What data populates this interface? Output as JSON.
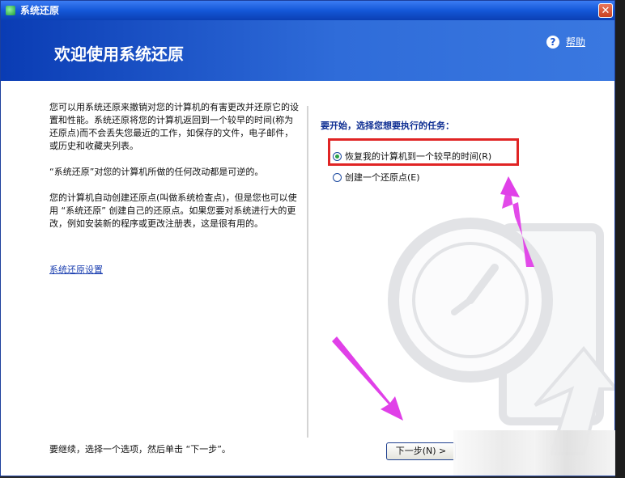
{
  "window": {
    "title": "系统还原",
    "close_glyph": "✕"
  },
  "header": {
    "heading": "欢迎使用系统还原",
    "help_label": "帮助",
    "help_glyph": "?"
  },
  "left": {
    "paragraphs": [
      "您可以用系统还原来撤销对您的计算机的有害更改并还原它的设置和性能。系统还原将您的计算机返回到一个较早的时间(称为还原点)而不会丢失您最近的工作，如保存的文件，电子邮件，或历史和收藏夹列表。",
      "“系统还原”对您的计算机所做的任何改动都是可逆的。",
      "您的计算机自动创建还原点(叫做系统检查点)，但是您也可以使用 “系统还原” 创建自己的还原点。如果您要对系统进行大的更改，例如安装新的程序或更改注册表，这是很有用的。"
    ],
    "settings_link": "系统还原设置",
    "continue_hint": "要继续，选择一个选项，然后单击 “下一步”。"
  },
  "right": {
    "task_label": "要开始，选择您想要执行的任务：",
    "options": [
      {
        "label": "恢复我的计算机到一个较早的时间(R)",
        "checked": true
      },
      {
        "label": "创建一个还原点(E)",
        "checked": false
      }
    ],
    "next_button": "下一步(N) >"
  },
  "colors": {
    "header_blue": "#0a3cb4",
    "annotation_box": "#e02424",
    "annotation_arrow": "#e040e8"
  },
  "icons": [
    "help-icon",
    "close-icon",
    "app-icon",
    "clock-watermark-icon",
    "annotation-arrow-icon"
  ]
}
